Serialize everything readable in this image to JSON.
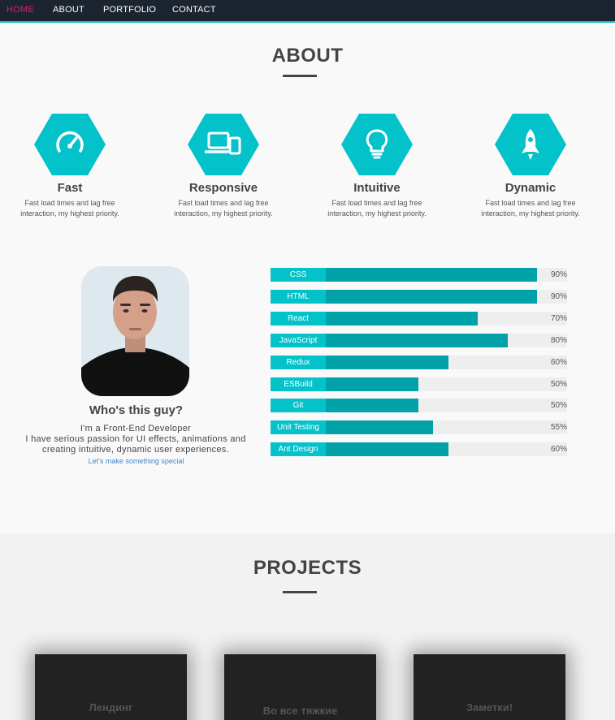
{
  "nav": {
    "items": [
      "HOME",
      "ABOUT",
      "PORTFOLIO",
      "CONTACT"
    ],
    "active": "HOME"
  },
  "about": {
    "heading": "ABOUT",
    "features": [
      {
        "title": "Fast",
        "icon": "speedometer-icon",
        "description": "Fast load times and lag free interaction, my highest priority."
      },
      {
        "title": "Responsive",
        "icon": "devices-icon",
        "description": "Fast load times and lag free interaction, my highest priority."
      },
      {
        "title": "Intuitive",
        "icon": "lightbulb-icon",
        "description": "Fast load times and lag free interaction, my highest priority."
      },
      {
        "title": "Dynamic",
        "icon": "rocket-icon",
        "description": "Fast load times and lag free interaction, my highest priority."
      }
    ]
  },
  "profile": {
    "heading": "Who's this guy?",
    "bio_line1": "I'm a Front-End Developer",
    "bio_line2": "I have serious passion for UI effects, animations and creating intuitive, dynamic user experiences.",
    "link": "Let's make something special"
  },
  "skills": [
    {
      "name": "CSS",
      "percent": 90,
      "label": "90%"
    },
    {
      "name": "HTML",
      "percent": 90,
      "label": "90%"
    },
    {
      "name": "React",
      "percent": 70,
      "label": "70%"
    },
    {
      "name": "JavaScript",
      "percent": 80,
      "label": "80%"
    },
    {
      "name": "Redux",
      "percent": 60,
      "label": "60%"
    },
    {
      "name": "ESBuild",
      "percent": 50,
      "label": "50%"
    },
    {
      "name": "Git",
      "percent": 50,
      "label": "50%"
    },
    {
      "name": "Unit Testing",
      "percent": 55,
      "label": "55%"
    },
    {
      "name": "Ant Design",
      "percent": 60,
      "label": "60%"
    }
  ],
  "projects": {
    "heading": "PROJECTS",
    "cards": [
      "Лендинг",
      "Во все тяжкие",
      "Заметки!"
    ]
  },
  "colors": {
    "accent": "#04c2c9",
    "accent_dark": "#00a1a7",
    "nav_bg": "#1b242f",
    "active_nav": "#e31b6d",
    "link": "#3f89c9"
  }
}
